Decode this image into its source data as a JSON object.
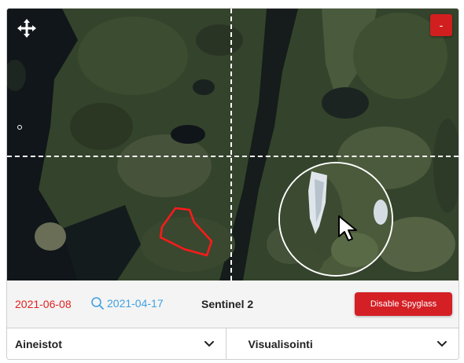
{
  "map": {
    "move_icon": "move-cross-icon",
    "collapse_label": "-",
    "cursor_icon": "mouse-pointer-icon"
  },
  "toolbar": {
    "date_main": "2021-06-08",
    "compare_icon": "search-icon",
    "date_compare": "2021-04-17",
    "sensor": "Sentinel 2",
    "spyglass_button": "Disable Spyglass"
  },
  "dropdowns": {
    "datasets": "Aineistot",
    "visualization": "Visualisointi",
    "chevron_icon": "chevron-down-icon"
  },
  "colors": {
    "accent_red": "#d41f25",
    "date_main": "#e21f1f",
    "date_compare": "#3fa2e3"
  }
}
